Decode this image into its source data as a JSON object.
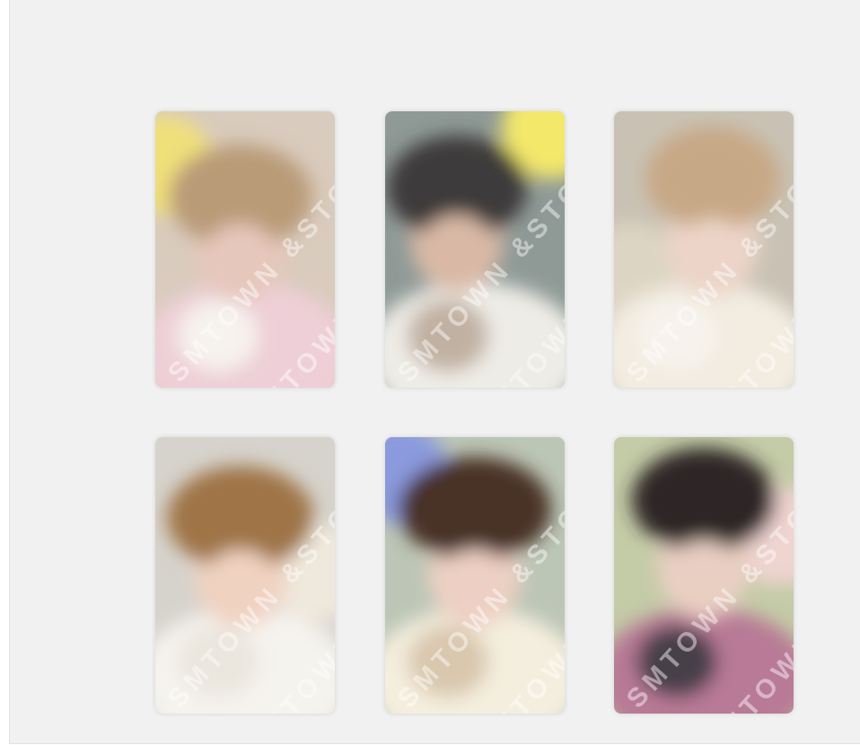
{
  "gallery": {
    "watermark_text": "SMTOWN &STORE",
    "cards": [
      {
        "name": "photocard-1",
        "bg": "#d9cbbd",
        "accent": "#f0e07a",
        "hair": "#b99b78",
        "skin": "#e6c7bb",
        "shirt": "#eecfd7",
        "shirt2": "#f6f2ee"
      },
      {
        "name": "photocard-2",
        "bg": "#8f9a97",
        "accent": "#f3e86a",
        "hair": "#3d3a3a",
        "skin": "#d9b9a6",
        "shirt": "#eeece6",
        "shirt2": "#c1b1a2"
      },
      {
        "name": "photocard-3",
        "bg": "#c9c2b4",
        "accent": "#ddd5c3",
        "hair": "#c7a886",
        "skin": "#ecd4c8",
        "shirt": "#f2ece1",
        "shirt2": "#f7f3ec"
      },
      {
        "name": "photocard-4",
        "bg": "#d6d3cc",
        "accent": "#efe8dc",
        "hair": "#9f7446",
        "skin": "#f0d2c1",
        "shirt": "#f5f3ee",
        "shirt2": "#ebe6de"
      },
      {
        "name": "photocard-5",
        "bg": "#bcc6b6",
        "accent": "#8b9ade",
        "hair": "#4a3028",
        "skin": "#edd0c3",
        "shirt": "#f4eede",
        "shirt2": "#d9c7ae"
      },
      {
        "name": "photocard-6",
        "bg": "#c4cba7",
        "accent": "#efd4d0",
        "hair": "#2d2828",
        "skin": "#e9cfc2",
        "shirt": "#b87a96",
        "shirt2": "#473f48"
      }
    ]
  }
}
